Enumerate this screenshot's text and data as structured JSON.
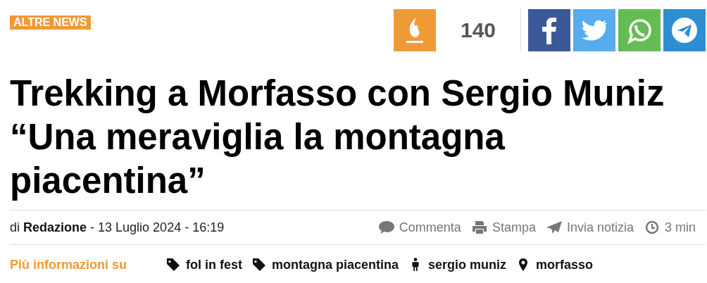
{
  "category": "ALTRE NEWS",
  "counter": "140",
  "share_buttons": [
    {
      "kind": "facebook"
    },
    {
      "kind": "twitter"
    },
    {
      "kind": "whatsapp"
    },
    {
      "kind": "telegram"
    }
  ],
  "title": "Trekking a Morfasso con Sergio Muniz “Una meraviglia la montagna piacentina”",
  "byline": "di **Redazione** - 13 Luglio 2024 - 16:19",
  "actions": [
    {
      "kind": "comment",
      "label": "Commenta"
    },
    {
      "kind": "print",
      "label": "Stampa"
    },
    {
      "kind": "send",
      "label": "Invia notizia"
    },
    {
      "kind": "clock",
      "label": "3 min"
    }
  ],
  "more_info_label": "Più informazioni su",
  "tags": [
    {
      "kind": "tag",
      "label": "fol in fest"
    },
    {
      "kind": "tag",
      "label": "montagna piacentina"
    },
    {
      "kind": "person",
      "label": "sergio muniz"
    },
    {
      "kind": "place",
      "label": "morfasso"
    }
  ]
}
